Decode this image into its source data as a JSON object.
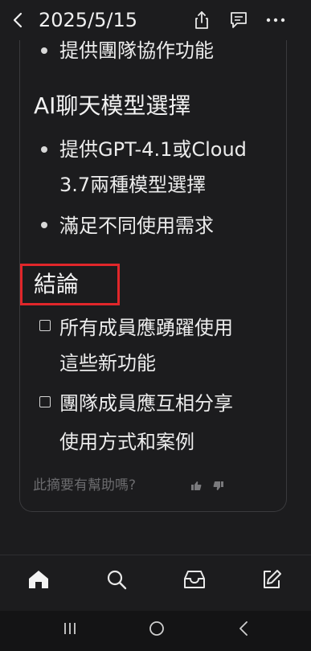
{
  "header": {
    "title": "2025/5/15",
    "back_icon": "chevron-left-icon",
    "share_icon": "share-icon",
    "comment_icon": "comment-icon",
    "more_icon": "more-horizontal-icon"
  },
  "content": {
    "top_bullet": "提供團隊協作功能",
    "ai_section": {
      "title": "AI聊天模型選擇",
      "bullets": [
        {
          "line1": "提供GPT-4.1或Cloud",
          "line2": "3.7兩種模型選擇"
        },
        {
          "line1": "滿足不同使用需求",
          "line2": ""
        }
      ]
    },
    "conclusion": {
      "title": "結論",
      "items": [
        {
          "line1": "所有成員應踴躍使用",
          "line2": "這些新功能"
        },
        {
          "line1": "團隊成員應互相分享",
          "line2": "使用方式和案例"
        }
      ]
    },
    "feedback": {
      "question": "此摘要有幫助嗎?",
      "thumbs_up_icon": "thumbs-up-icon",
      "thumbs_down_icon": "thumbs-down-icon"
    }
  },
  "bottom_nav": {
    "items": [
      "home-icon",
      "search-icon",
      "inbox-icon",
      "compose-icon"
    ]
  },
  "system_nav": {
    "items": [
      "recent-apps-icon",
      "home-circle-icon",
      "back-icon"
    ]
  },
  "colors": {
    "background": "#1c1c1e",
    "text": "#ececec",
    "muted": "#6b6b6e",
    "highlight": "#e0262a"
  }
}
